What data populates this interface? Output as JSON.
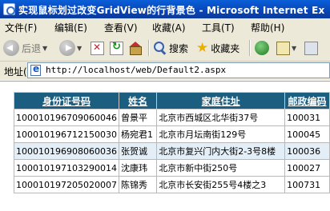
{
  "window": {
    "title": "实现鼠标划过改变GridView的行背景色 - Microsoft Internet Ex"
  },
  "menu": [
    "文件(F)",
    "编辑(E)",
    "查看(V)",
    "收藏(A)",
    "工具(T)",
    "帮助(H)"
  ],
  "toolbar": {
    "back_label": "后退",
    "search_label": "搜索",
    "favorites_label": "收藏夹"
  },
  "address": {
    "label": "地址(D)",
    "url": "http://localhost/web/Default2.aspx"
  },
  "grid": {
    "headers": [
      "身份证号码",
      "姓名",
      "家庭住址",
      "邮政编码"
    ],
    "highlight_row_index": 2,
    "rows": [
      [
        "100010196709060046",
        "曾景平",
        "北京市西城区北华街37号",
        "100031"
      ],
      [
        "100010196712150030",
        "杨宛君1",
        "北京市月坛南街129号",
        "100045"
      ],
      [
        "100010196908060036",
        "张贺诚",
        "北京市复兴门内大街2-3号8楼",
        "100036"
      ],
      [
        "100010197103290014",
        "沈康玮",
        "北京市新中街250号",
        "100027"
      ],
      [
        "100010197205020007",
        "陈锦秀",
        "北京市长安街255号4楼之3",
        "100731"
      ]
    ]
  }
}
